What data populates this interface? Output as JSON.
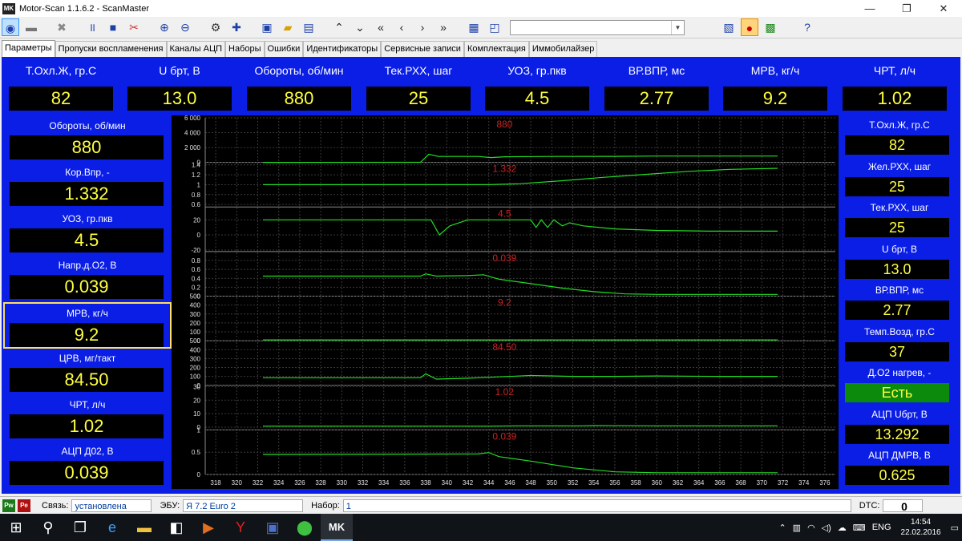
{
  "window": {
    "title": "Motor-Scan 1.1.6.2 - ScanMaster",
    "logo_text": "MK"
  },
  "window_buttons": [
    "—",
    "❐",
    "✕"
  ],
  "toolbar": {
    "combo_value": "",
    "icons": [
      "connect-icon",
      "disconnect-icon",
      "tools-icon",
      "pause-icon",
      "stop-icon",
      "clear-icon",
      "zoom-in-icon",
      "zoom-out-icon",
      "settings-icon",
      "add-icon",
      "save-icon",
      "open-icon",
      "export-icon",
      "up-icon",
      "down-icon",
      "rewind-icon",
      "prev-icon",
      "next-icon",
      "fast-forward-icon",
      "calculator-icon",
      "window-icon",
      "report-icon",
      "record-icon",
      "excel-icon",
      "help-icon"
    ]
  },
  "tabs": [
    "Параметры",
    "Пропуски воспламенения",
    "Каналы АЦП",
    "Наборы",
    "Ошибки",
    "Идентификаторы",
    "Сервисные записи",
    "Комплектация",
    "Иммобилайзер"
  ],
  "top_params": [
    {
      "label": "Т.Охл.Ж, гр.С",
      "value": "82"
    },
    {
      "label": "U брт, В",
      "value": "13.0"
    },
    {
      "label": "Обороты, об/мин",
      "value": "880"
    },
    {
      "label": "Тек.РХХ, шаг",
      "value": "25"
    },
    {
      "label": "УОЗ, гр.пкв",
      "value": "4.5"
    },
    {
      "label": "ВР.ВПР, мс",
      "value": "2.77"
    },
    {
      "label": "МРВ, кг/ч",
      "value": "9.2"
    },
    {
      "label": "ЧРТ, л/ч",
      "value": "1.02"
    }
  ],
  "left_params": [
    {
      "label": "Обороты, об/мин",
      "value": "880"
    },
    {
      "label": "Кор.Впр, -",
      "value": "1.332"
    },
    {
      "label": "УОЗ, гр.пкв",
      "value": "4.5"
    },
    {
      "label": "Напр.д.О2, В",
      "value": "0.039"
    },
    {
      "label": "МРВ, кг/ч",
      "value": "9.2"
    },
    {
      "label": "ЦРВ, мг/такт",
      "value": "84.50"
    },
    {
      "label": "ЧРТ, л/ч",
      "value": "1.02"
    },
    {
      "label": "АЦП Д02, В",
      "value": "0.039"
    }
  ],
  "right_params": [
    {
      "label": "Т.Охл.Ж, гр.С",
      "value": "82"
    },
    {
      "label": "Жел.РХХ, шаг",
      "value": "25"
    },
    {
      "label": "Тек.РХХ, шаг",
      "value": "25"
    },
    {
      "label": "U брт, В",
      "value": "13.0"
    },
    {
      "label": "ВР.ВПР, мс",
      "value": "2.77"
    },
    {
      "label": "Темп.Возд, гр.С",
      "value": "37"
    },
    {
      "label": "Д.О2 нагрев, -",
      "value": "Есть"
    },
    {
      "label": "АЦП Uбрт, В",
      "value": "13.292"
    },
    {
      "label": "АЦП ДМРВ, В",
      "value": "0.625"
    }
  ],
  "chart_data": {
    "type": "line",
    "x_ticks": [
      318,
      320,
      322,
      324,
      326,
      328,
      330,
      332,
      334,
      336,
      338,
      340,
      342,
      344,
      346,
      348,
      350,
      352,
      354,
      356,
      358,
      360,
      362,
      364,
      366,
      368,
      370,
      372,
      374,
      376
    ],
    "xlim": [
      317,
      377
    ],
    "data_xlim": [
      322.5,
      371.5
    ],
    "colors": {
      "line": "#22dd22",
      "current_value": "#cc2222",
      "grid": "#3a3a3a",
      "axis_text": "#e0e0e0"
    },
    "panels": [
      {
        "current": "880",
        "ylim": [
          0,
          6000
        ],
        "yticks": [
          "6 000",
          "4 000",
          "2 000",
          "0"
        ],
        "tickvals": [
          6000,
          4000,
          2000,
          0
        ],
        "points": [
          [
            322.5,
            0
          ],
          [
            337.5,
            20
          ],
          [
            338.3,
            1100
          ],
          [
            339.2,
            800
          ],
          [
            343,
            800
          ],
          [
            344.2,
            650
          ],
          [
            345.5,
            760
          ],
          [
            350,
            800
          ],
          [
            356,
            810
          ],
          [
            360,
            860
          ],
          [
            366,
            860
          ],
          [
            371.5,
            850
          ]
        ]
      },
      {
        "current": "1.332",
        "ylim": [
          0.55,
          1.45
        ],
        "yticks": [
          "1.4",
          "1.2",
          "1",
          "0.8",
          "0.6"
        ],
        "tickvals": [
          1.4,
          1.2,
          1,
          0.8,
          0.6
        ],
        "points": [
          [
            322.5,
            1.0
          ],
          [
            344,
            1.0
          ],
          [
            347,
            1.02
          ],
          [
            351,
            1.08
          ],
          [
            355,
            1.15
          ],
          [
            359,
            1.21
          ],
          [
            363,
            1.27
          ],
          [
            367,
            1.31
          ],
          [
            371.5,
            1.33
          ]
        ]
      },
      {
        "current": "4.5",
        "ylim": [
          -22,
          37
        ],
        "yticks": [
          "20",
          "0",
          "-20"
        ],
        "tickvals": [
          20,
          0,
          -20
        ],
        "points": [
          [
            322.5,
            20
          ],
          [
            338.5,
            20
          ],
          [
            339.3,
            0
          ],
          [
            340.3,
            12
          ],
          [
            342,
            20
          ],
          [
            346,
            20
          ],
          [
            348,
            20
          ],
          [
            348.5,
            10
          ],
          [
            349,
            20
          ],
          [
            349.6,
            10
          ],
          [
            350.2,
            20
          ],
          [
            351,
            12
          ],
          [
            351.7,
            16
          ],
          [
            353,
            12
          ],
          [
            356,
            8
          ],
          [
            360,
            6
          ],
          [
            365,
            5
          ],
          [
            371.5,
            5
          ]
        ]
      },
      {
        "current": "0.039",
        "ylim": [
          0,
          1
        ],
        "yticks": [
          "0.8",
          "0.6",
          "0.4",
          "0.2",
          "0"
        ],
        "tickvals": [
          0.8,
          0.6,
          0.4,
          0.2,
          0
        ],
        "points": [
          [
            322.5,
            0.45
          ],
          [
            337.5,
            0.45
          ],
          [
            338,
            0.5
          ],
          [
            339,
            0.45
          ],
          [
            342,
            0.46
          ],
          [
            343.5,
            0.48
          ],
          [
            345,
            0.38
          ],
          [
            348,
            0.28
          ],
          [
            351,
            0.18
          ],
          [
            354,
            0.1
          ],
          [
            357,
            0.05
          ],
          [
            360,
            0.04
          ],
          [
            371.5,
            0.04
          ]
        ]
      },
      {
        "current": "9.2",
        "ylim": [
          0,
          500
        ],
        "yticks": [
          "500",
          "400",
          "300",
          "200",
          "100",
          "0"
        ],
        "tickvals": [
          500,
          400,
          300,
          200,
          100,
          0
        ],
        "points": [
          [
            322.5,
            9
          ],
          [
            371.5,
            9
          ]
        ]
      },
      {
        "current": "84.50",
        "ylim": [
          0,
          500
        ],
        "yticks": [
          "500",
          "400",
          "300",
          "200",
          "100",
          "0"
        ],
        "tickvals": [
          500,
          400,
          300,
          200,
          100,
          0
        ],
        "points": [
          [
            322.5,
            85
          ],
          [
            337.5,
            85
          ],
          [
            338,
            130
          ],
          [
            339,
            70
          ],
          [
            342,
            80
          ],
          [
            345,
            95
          ],
          [
            348,
            110
          ],
          [
            352,
            100
          ],
          [
            356,
            100
          ],
          [
            360,
            105
          ],
          [
            366,
            100
          ],
          [
            371.5,
            100
          ]
        ]
      },
      {
        "current": "1.02",
        "ylim": [
          -2,
          31
        ],
        "yticks": [
          "30",
          "20",
          "10",
          "0"
        ],
        "tickvals": [
          30,
          20,
          10,
          0
        ],
        "points": [
          [
            322.5,
            0.8
          ],
          [
            344,
            0.8
          ],
          [
            347,
            1.0
          ],
          [
            353,
            1.0
          ],
          [
            354,
            1.2
          ],
          [
            360,
            1.0
          ],
          [
            371.5,
            1.0
          ]
        ]
      },
      {
        "current": "0.039",
        "ylim": [
          0,
          1
        ],
        "yticks": [
          "1",
          "0.5",
          "0"
        ],
        "tickvals": [
          1,
          0.5,
          0
        ],
        "points": [
          [
            322.5,
            0.45
          ],
          [
            343,
            0.46
          ],
          [
            344,
            0.49
          ],
          [
            345,
            0.4
          ],
          [
            348,
            0.3
          ],
          [
            352,
            0.15
          ],
          [
            356,
            0.06
          ],
          [
            360,
            0.04
          ],
          [
            371.5,
            0.04
          ]
        ]
      }
    ]
  },
  "status": {
    "conn_label": "Связь:",
    "conn_value": "установлена",
    "ecu_label": "ЭБУ:",
    "ecu_value": "Я 7.2 Euro 2",
    "set_label": "Набор:",
    "set_value": "1",
    "dtc_label": "DTC:",
    "dtc_value": "0",
    "pw_text": "Pw",
    "pe_text": "Pe"
  },
  "taskbar": {
    "apps": [
      "start-icon",
      "search-icon",
      "task-view-icon",
      "edge-icon",
      "explorer-icon",
      "store-icon",
      "media-icon",
      "yandex-icon",
      "save-app-icon",
      "torrent-icon",
      "motorscan-icon"
    ],
    "lang": "ENG",
    "time": "14:54",
    "date": "22.02.2016"
  }
}
